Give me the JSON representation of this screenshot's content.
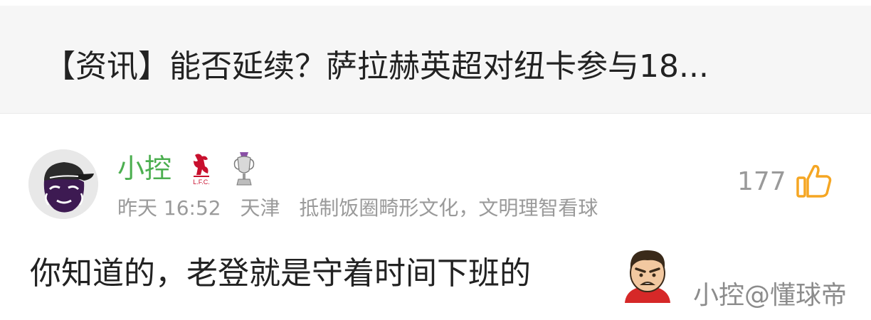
{
  "header": {
    "title": "【资讯】能否延续？萨拉赫英超对纽卡参与18..."
  },
  "comment": {
    "username": "小控",
    "badges": [
      "lfc-liverbird-icon",
      "premier-league-trophy-icon"
    ],
    "time": "昨天 16:52",
    "location": "天津",
    "signature": "抵制饭圈畸形文化，文明理智看球",
    "likes": "177",
    "text": "你知道的，老登就是守着时间下班的",
    "emoji": "angry-face-emoji"
  },
  "watermark": "小控@懂球帝",
  "colors": {
    "username": "#4caf50",
    "like_icon": "#f5a623",
    "header_bg": "#f6f6f6",
    "meta_text": "#9a9a9a"
  }
}
